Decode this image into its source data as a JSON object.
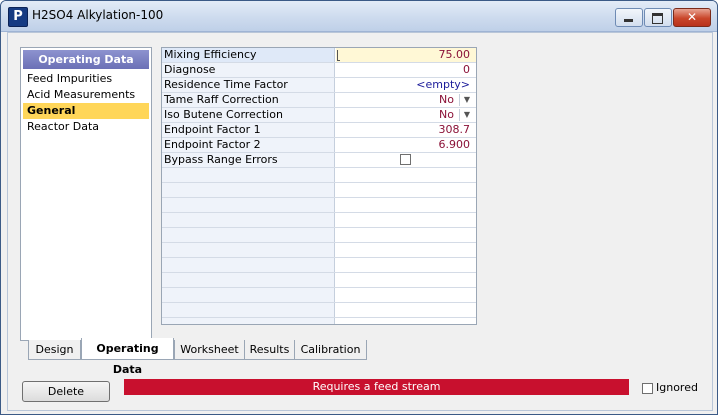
{
  "window": {
    "app_icon_letter": "P",
    "title": "H2SO4 Alkylation-100",
    "close_glyph": "✕"
  },
  "nav": {
    "header": "Operating Data",
    "items": [
      {
        "label": "Feed Impurities",
        "active": false
      },
      {
        "label": "Acid Measurements",
        "active": false
      },
      {
        "label": "General",
        "active": true
      },
      {
        "label": "Reactor Data",
        "active": false
      }
    ]
  },
  "grid": {
    "rows": [
      {
        "label": "Mixing Efficiency",
        "value": "75.00",
        "type": "number",
        "selected": true
      },
      {
        "label": "Diagnose",
        "value": "0",
        "type": "number"
      },
      {
        "label": "Residence Time Factor",
        "value": "<empty>",
        "type": "empty"
      },
      {
        "label": "Tame Raff Correction",
        "value": "No",
        "type": "dropdown"
      },
      {
        "label": "Iso Butene Correction",
        "value": "No",
        "type": "dropdown"
      },
      {
        "label": "Endpoint Factor 1",
        "value": "308.7",
        "type": "number"
      },
      {
        "label": "Endpoint Factor 2",
        "value": "6.900",
        "type": "number"
      },
      {
        "label": "Bypass Range Errors",
        "value": "",
        "type": "checkbox",
        "checked": false
      }
    ]
  },
  "tabs": [
    {
      "label": "Design",
      "active": false
    },
    {
      "label": "Operating Data",
      "active": true
    },
    {
      "label": "Worksheet",
      "active": false
    },
    {
      "label": "Results",
      "active": false
    },
    {
      "label": "Calibration",
      "active": false
    }
  ],
  "footer": {
    "delete_label": "Delete",
    "status_text": "Requires a feed stream",
    "status_color": "#c8102e",
    "ignored_label": "Ignored",
    "ignored_checked": false
  },
  "colors": {
    "nav_header": "#6b70b6",
    "nav_active": "#ffd659",
    "value_text": "#8b1238"
  }
}
